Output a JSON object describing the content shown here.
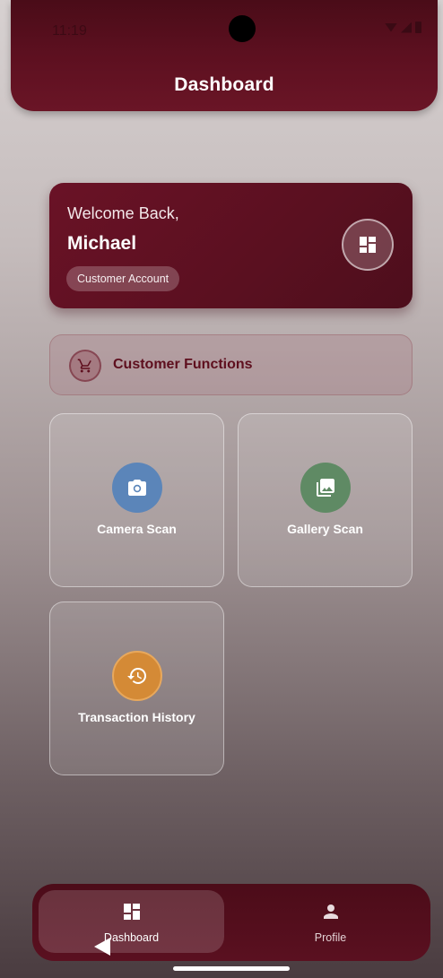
{
  "status_bar": {
    "time": "11:19"
  },
  "header": {
    "title": "Dashboard"
  },
  "welcome": {
    "greeting": "Welcome Back,",
    "name": "Michael",
    "badge": "Customer Account",
    "icon": "dashboard-icon"
  },
  "section": {
    "title": "Customer Functions",
    "icon": "cart-icon"
  },
  "tiles": [
    {
      "label": "Camera Scan",
      "icon": "camera-icon",
      "color": "#5b85b9"
    },
    {
      "label": "Gallery Scan",
      "icon": "gallery-icon",
      "color": "#5f8a64"
    },
    {
      "label": "Transaction History",
      "icon": "history-icon",
      "color": "#d48a36"
    }
  ],
  "bottom_nav": {
    "items": [
      {
        "label": "Dashboard",
        "icon": "dashboard-icon",
        "active": true
      },
      {
        "label": "Profile",
        "icon": "person-icon",
        "active": false
      }
    ]
  },
  "colors": {
    "primary": "#5a1020",
    "accent_text": "#5e0f1e"
  }
}
